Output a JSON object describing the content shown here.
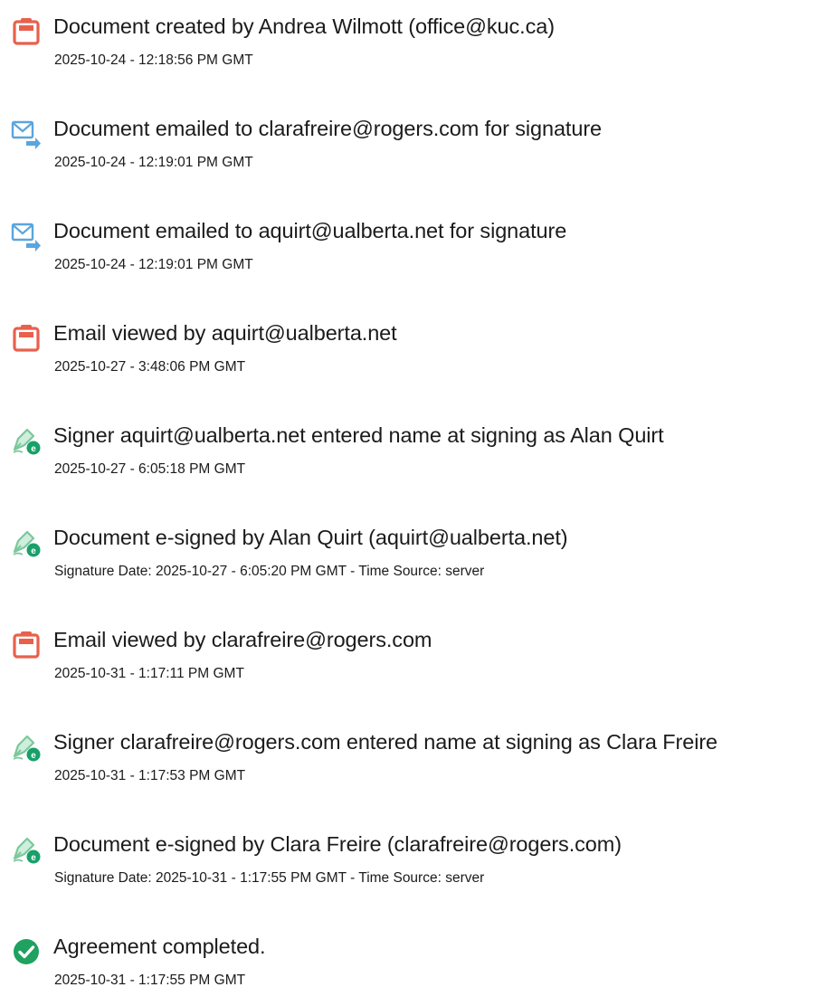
{
  "colors": {
    "doc_icon": "#e8604c",
    "email_icon": "#5aa5de",
    "sign_icon_pen": "#8fcfa8",
    "sign_icon_badge": "#18a06a",
    "complete_icon": "#1fa15f",
    "text": "#1b1b1b"
  },
  "events": [
    {
      "icon": "document-icon",
      "title": "Document created by Andrea Wilmott (office@kuc.ca)",
      "stamp": "2025-10-24 - 12:18:56 PM GMT"
    },
    {
      "icon": "email-sent-icon",
      "title": "Document emailed to clarafreire@rogers.com for signature",
      "stamp": "2025-10-24 - 12:19:01 PM GMT"
    },
    {
      "icon": "email-sent-icon",
      "title": "Document emailed to aquirt@ualberta.net for signature",
      "stamp": "2025-10-24 - 12:19:01 PM GMT"
    },
    {
      "icon": "document-icon",
      "title": "Email viewed by aquirt@ualberta.net",
      "stamp": "2025-10-27 - 3:48:06 PM GMT"
    },
    {
      "icon": "e-sign-pen-icon",
      "title": "Signer aquirt@ualberta.net entered name at signing as Alan Quirt",
      "stamp": "2025-10-27 - 6:05:18 PM GMT"
    },
    {
      "icon": "e-sign-pen-icon",
      "title": "Document e-signed by Alan Quirt (aquirt@ualberta.net)",
      "stamp": "Signature Date: 2025-10-27 - 6:05:20 PM GMT - Time Source: server"
    },
    {
      "icon": "document-icon",
      "title": "Email viewed by clarafreire@rogers.com",
      "stamp": "2025-10-31 - 1:17:11 PM GMT"
    },
    {
      "icon": "e-sign-pen-icon",
      "title": "Signer clarafreire@rogers.com entered name at signing as Clara Freire",
      "stamp": "2025-10-31 - 1:17:53 PM GMT"
    },
    {
      "icon": "e-sign-pen-icon",
      "title": "Document e-signed by Clara Freire (clarafreire@rogers.com)",
      "stamp": "Signature Date: 2025-10-31 - 1:17:55 PM GMT - Time Source: server"
    },
    {
      "icon": "check-circle-icon",
      "title": "Agreement completed.",
      "stamp": "2025-10-31 - 1:17:55 PM GMT"
    }
  ]
}
